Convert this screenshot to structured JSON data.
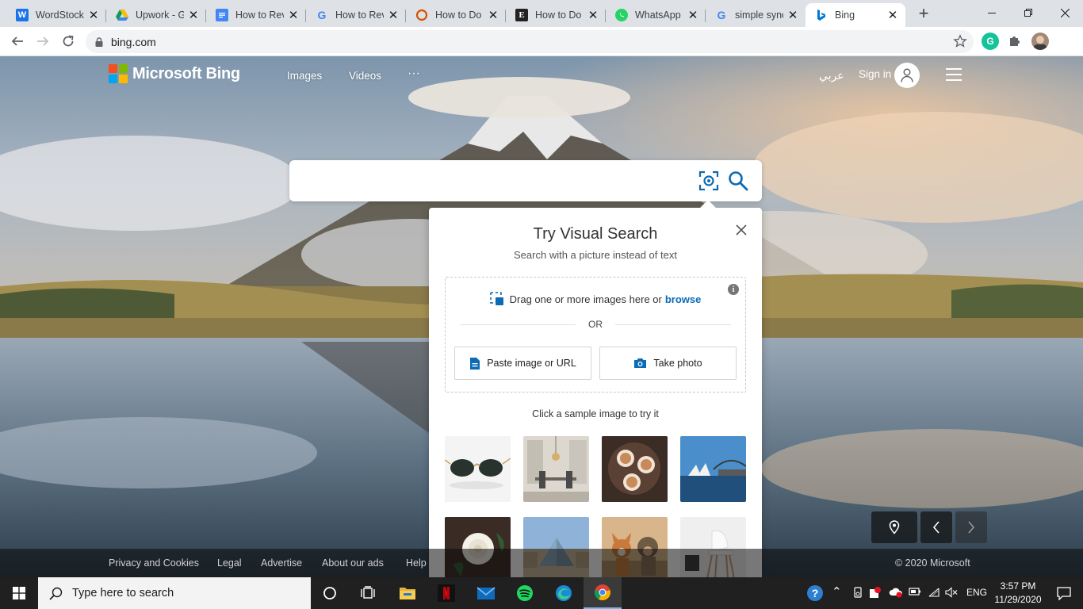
{
  "browser": {
    "tabs": [
      {
        "title": "WordStock",
        "icon": "wordstock-icon",
        "color": "#1a73e8"
      },
      {
        "title": "Upwork - G",
        "icon": "google-drive-icon",
        "color": "#0f9d58"
      },
      {
        "title": "How to Rev",
        "icon": "google-docs-icon",
        "color": "#4285f4"
      },
      {
        "title": "How to Rev",
        "icon": "google-icon",
        "color": "#4285f4"
      },
      {
        "title": "How to Do",
        "icon": "ring-icon",
        "color": "#d35400"
      },
      {
        "title": "How to Do",
        "icon": "e-icon",
        "color": "#222222"
      },
      {
        "title": "WhatsApp",
        "icon": "whatsapp-icon",
        "color": "#25d366"
      },
      {
        "title": "simple sync",
        "icon": "google-icon",
        "color": "#4285f4"
      },
      {
        "title": "Bing",
        "icon": "bing-icon",
        "color": "#0078d4"
      }
    ],
    "url": "bing.com"
  },
  "bing": {
    "brand": "Microsoft Bing",
    "nav": [
      "Images",
      "Videos",
      "···"
    ],
    "language": "عربي",
    "signin": "Sign in",
    "search_value": ""
  },
  "visual_search": {
    "title": "Try Visual Search",
    "subtitle": "Search with a picture instead of text",
    "drag_text": "Drag one or more images here or",
    "browse": "browse",
    "info": "i",
    "or": "OR",
    "paste": "Paste image or URL",
    "take_photo": "Take photo",
    "sample_title": "Click a sample image to try it"
  },
  "footer": {
    "links": [
      "Privacy and Cookies",
      "Legal",
      "Advertise",
      "About our ads",
      "Help"
    ],
    "copyright": "© 2020 Microsoft"
  },
  "taskbar": {
    "search_placeholder": "Type here to search",
    "language": "ENG",
    "time": "3:57 PM",
    "date": "11/29/2020"
  },
  "colors": {
    "accent": "#0c6bb5",
    "bing_blue": "#0078d4",
    "taskbar": "#202020"
  }
}
